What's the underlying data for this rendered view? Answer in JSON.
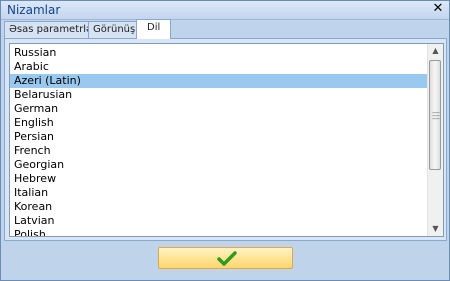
{
  "window": {
    "title": "Nizamlar",
    "close_icon": "close-icon"
  },
  "tabs": [
    {
      "label": "Əsas parametrlər",
      "active": false
    },
    {
      "label": "Görünüş",
      "active": false
    },
    {
      "label": "Dil",
      "active": true
    }
  ],
  "languages": [
    "Russian",
    "Arabic",
    "Azeri (Latin)",
    "Belarusian",
    "German",
    "English",
    "Persian",
    "French",
    "Georgian",
    "Hebrew",
    "Italian",
    "Korean",
    "Latvian",
    "Polish"
  ],
  "selected_language": "Azeri (Latin)",
  "ok_button": {
    "icon": "checkmark-icon",
    "color": "#3aa52a"
  },
  "colors": {
    "selection": "#99c9ef",
    "button": "#ffd66b"
  }
}
